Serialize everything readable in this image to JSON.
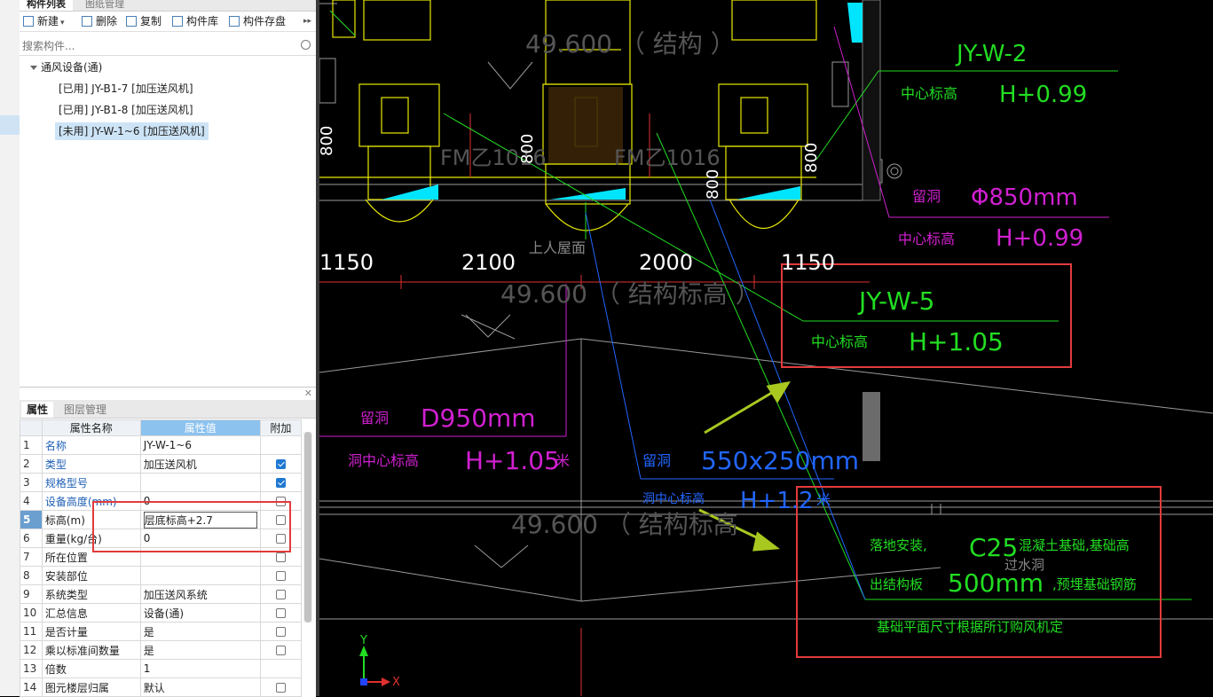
{
  "panel_tabs": [
    "构件列表",
    "图纸管理"
  ],
  "toolbar": {
    "new": "新建",
    "delete": "删除",
    "copy": "复制",
    "library": "构件库",
    "save": "构件存盘"
  },
  "search": {
    "placeholder": "搜索构件..."
  },
  "tree": {
    "root": "通风设备(通)",
    "items": [
      "[已用] JY-B1-7 [加压送风机]",
      "[已用] JY-B1-8 [加压送风机]",
      "[未用] JY-W-1~6 [加压送风机]"
    ]
  },
  "prop_tabs": [
    "属性",
    "图层管理"
  ],
  "prop_headers": {
    "name": "属性名称",
    "value": "属性值",
    "extra": "附加"
  },
  "props": [
    {
      "n": "1",
      "name": "名称",
      "value": "JY-W-1~6",
      "chk": "none"
    },
    {
      "n": "2",
      "name": "类型",
      "value": "加压送风机",
      "chk": "on"
    },
    {
      "n": "3",
      "name": "规格型号",
      "value": "",
      "chk": "on"
    },
    {
      "n": "4",
      "name": "设备高度(mm)",
      "value": "0",
      "chk": "off"
    },
    {
      "n": "5",
      "name": "标高(m)",
      "value": "层底标高+2.7",
      "chk": "off"
    },
    {
      "n": "6",
      "name": "重量(kg/台)",
      "value": "0",
      "chk": "off"
    },
    {
      "n": "7",
      "name": "所在位置",
      "value": "",
      "chk": "off"
    },
    {
      "n": "8",
      "name": "安装部位",
      "value": "",
      "chk": "off"
    },
    {
      "n": "9",
      "name": "系统类型",
      "value": "加压送风系统",
      "chk": "off"
    },
    {
      "n": "10",
      "name": "汇总信息",
      "value": "设备(通)",
      "chk": "off"
    },
    {
      "n": "11",
      "name": "是否计量",
      "value": "是",
      "chk": "off"
    },
    {
      "n": "12",
      "name": "乘以标准间数量",
      "value": "是",
      "chk": "off"
    },
    {
      "n": "13",
      "name": "倍数",
      "value": "1",
      "chk": "off"
    },
    {
      "n": "14",
      "name": "图元楼层归属",
      "value": "默认",
      "chk": "off"
    }
  ],
  "cad": {
    "elev_top": "49.600  （ 结构  ）",
    "elev_mid": "49.600  （ 结构标高    ）",
    "elev_bot": "49.600  （ 结构标高",
    "fm1": "FM乙1016",
    "fm2": "FM乙1016",
    "dim_800_1": "800",
    "dim_800_2": "800",
    "dim_800_3": "800",
    "dim_800_4": "800",
    "dim_1150_l": "1150",
    "dim_2100": "2100",
    "dim_2000": "2000",
    "dim_1150_r": "1150",
    "roof": "上人屋面",
    "jyw2": "JY-W-2",
    "center_h1": "中心标高",
    "h099_1": "H+0.99",
    "hole1": "留洞",
    "d850": "Φ850mm",
    "center_h2": "中心标高",
    "h099_2": "H+0.99",
    "jyw5": "JY-W-5",
    "center_h3": "中心标高",
    "h105_1": "H+1.05",
    "hole2": "留洞",
    "d950": "D950mm",
    "hole_center": "洞中心标高",
    "h105_2": "H+1.05",
    "m1": "米",
    "hole3": "留洞",
    "rect550": "550x250mm",
    "center_h4": "洞中心标高",
    "h12": "H+1.2",
    "m2": "米",
    "floor_install": "落地安装,",
    "c25": "C25",
    "concrete": "混凝土基础,基础高",
    "guoshui": "过水洞",
    "above_board": "出结构板",
    "mm500": "500mm",
    "rebar": ",预埋基础钢筋",
    "foundation": "基础平面尺寸根据所订购风机定",
    "axis_x": "X",
    "axis_y": "Y"
  },
  "colors": {
    "accent_red": "#e23b3b",
    "cad_green": "#22dd22",
    "cad_magenta": "#d020d0",
    "cad_yellow": "#e8e800",
    "cad_cyan": "#00e5ff",
    "cad_blue": "#2266ff"
  }
}
